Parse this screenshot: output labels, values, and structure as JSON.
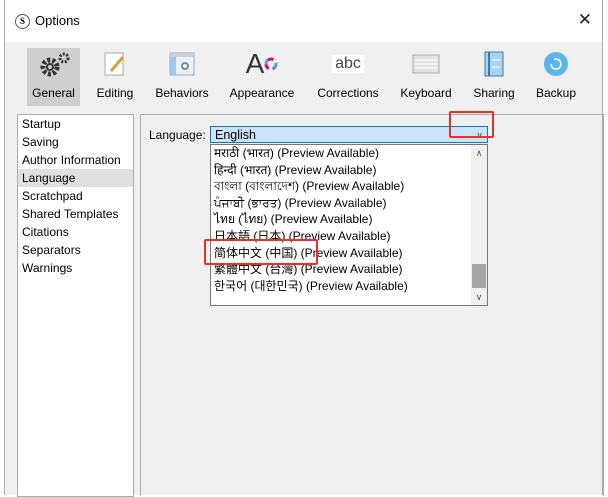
{
  "window": {
    "title": "Options",
    "logo": "S",
    "close": "✕"
  },
  "toolbar": [
    {
      "label": "General",
      "icon": "gears-icon",
      "selected": true
    },
    {
      "label": "Editing",
      "icon": "pencil-icon"
    },
    {
      "label": "Behaviors",
      "icon": "window-gear-icon"
    },
    {
      "label": "Appearance",
      "icon": "font-color-icon",
      "glyph": "A"
    },
    {
      "label": "Corrections",
      "icon": "abc-icon",
      "glyph": "abc"
    },
    {
      "label": "Keyboard",
      "icon": "keyboard-icon"
    },
    {
      "label": "Sharing",
      "icon": "sharing-icon"
    },
    {
      "label": "Backup",
      "icon": "backup-icon"
    }
  ],
  "sidebar": {
    "items": [
      "Startup",
      "Saving",
      "Author Information",
      "Language",
      "Scratchpad",
      "Shared Templates",
      "Citations",
      "Separators",
      "Warnings"
    ],
    "selected": "Language"
  },
  "language": {
    "label": "Language:",
    "value": "English",
    "options": [
      "मराठी (भारत) (Preview Available)",
      "हिन्दी (भारत) (Preview Available)",
      "বাংলা (বাংলাদেশ) (Preview Available)",
      "ਪੰਜਾਬੀ (ਭਾਰਤ) (Preview Available)",
      "ไทย (ไทย) (Preview Available)",
      "日本語 (日本) (Preview Available)",
      "简体中文 (中国) (Preview Available)",
      "繁體中文 (台灣) (Preview Available)",
      "한국어 (대한민국) (Preview Available)"
    ]
  },
  "colors": {
    "highlight": "#e8312a",
    "combo_bg": "#cce4f7"
  }
}
